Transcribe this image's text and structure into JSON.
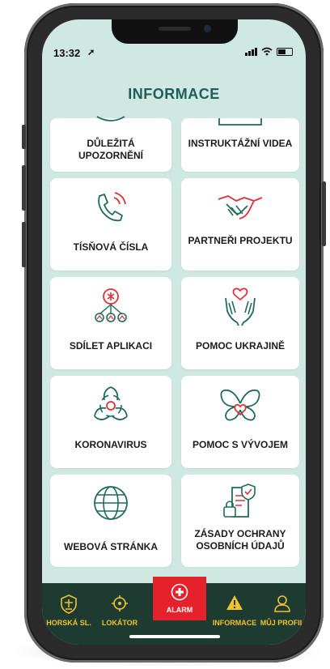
{
  "status": {
    "time": "13:32"
  },
  "header": {
    "title": "INFORMACE"
  },
  "tiles": [
    {
      "label": "DŮLEŽITÁ UPOZORNĚNÍ",
      "icon": "bell-icon"
    },
    {
      "label": "INSTRUKTÁŽNÍ VIDEA",
      "icon": "video-icon"
    },
    {
      "label": "TÍSŇOVÁ ČÍSLA",
      "icon": "phone-icon"
    },
    {
      "label": "PARTNEŘI PROJEKTU",
      "icon": "handshake-icon"
    },
    {
      "label": "SDÍLET APLIKACI",
      "icon": "share-network-icon"
    },
    {
      "label": "POMOC UKRAJINĚ",
      "icon": "hands-heart-icon"
    },
    {
      "label": "KORONAVIRUS",
      "icon": "biohazard-icon"
    },
    {
      "label": "POMOC S VÝVOJEM",
      "icon": "butterfly-icon"
    },
    {
      "label": "WEBOVÁ STRÁNKA",
      "icon": "globe-icon"
    },
    {
      "label": "ZÁSADY OCHRANY OSOBNÍCH ÚDAJŮ",
      "icon": "privacy-document-icon"
    }
  ],
  "nav": {
    "items": [
      {
        "label": "HORSKÁ SL.",
        "icon": "mountain-rescue-icon"
      },
      {
        "label": "LOKÁTOR",
        "icon": "crosshair-icon"
      },
      {
        "label": "ALARM",
        "icon": "alarm-plus-icon"
      },
      {
        "label": "INFORMACE",
        "icon": "warning-icon"
      },
      {
        "label": "MŮJ PROFIL",
        "icon": "user-icon"
      }
    ]
  },
  "colors": {
    "background": "#cfe8e1",
    "title": "#1e5e56",
    "icon_green": "#1f6b5c",
    "icon_red": "#e0303a",
    "navbar": "#1d3b31",
    "nav_text": "#f0c22d",
    "alarm": "#e5222b"
  }
}
